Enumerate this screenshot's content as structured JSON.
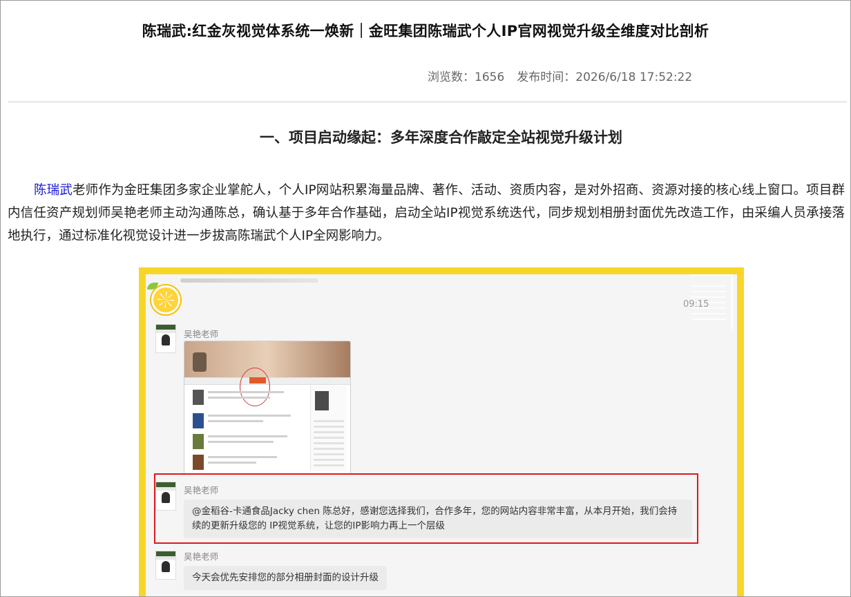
{
  "article": {
    "title": "陈瑞武:红金灰视觉体系统一焕新｜金旺集团陈瑞武个人IP官网视觉升级全维度对比剖析",
    "views_label": "浏览数：1656",
    "publish_label": "发布时间：2026/6/18 17:52:22",
    "section_title": "一、项目启动缘起：多年深度合作敲定全站视觉升级计划",
    "para_link": "陈瑞武",
    "para_text": "老师作为金旺集团多家企业掌舵人，个人IP网站积累海量品牌、著作、活动、资质内容，是对外招商、资源对接的核心线上窗口。项目群内信任资产规划师吴艳老师主动沟通陈总，确认基于多年合作基础，启动全站IP视觉系统迭代，同步规划相册封面优先改造工作，由采编人员承接落地执行，通过标准化视觉设计进一步拔高陈瑞武个人IP全网影响力。"
  },
  "chat": {
    "time": "09:15",
    "messages": [
      {
        "sender": "吴艳老师"
      },
      {
        "sender": "吴艳老师",
        "text": "@金稻谷-卡通食品Jacky chen  陈总好，感谢您选择我们，合作多年，您的网站内容非常丰富，从本月开始，我们会持续的更新升级您的 IP视觉系统，让您的IP影响力再上一个层级"
      },
      {
        "sender": "吴艳老师",
        "text": "今天会优先安排您的部分相册封面的设计升级"
      }
    ]
  },
  "colors": {
    "accent_yellow": "#f8d629",
    "highlight_red": "#e0171b",
    "link_blue": "#1818d8"
  }
}
